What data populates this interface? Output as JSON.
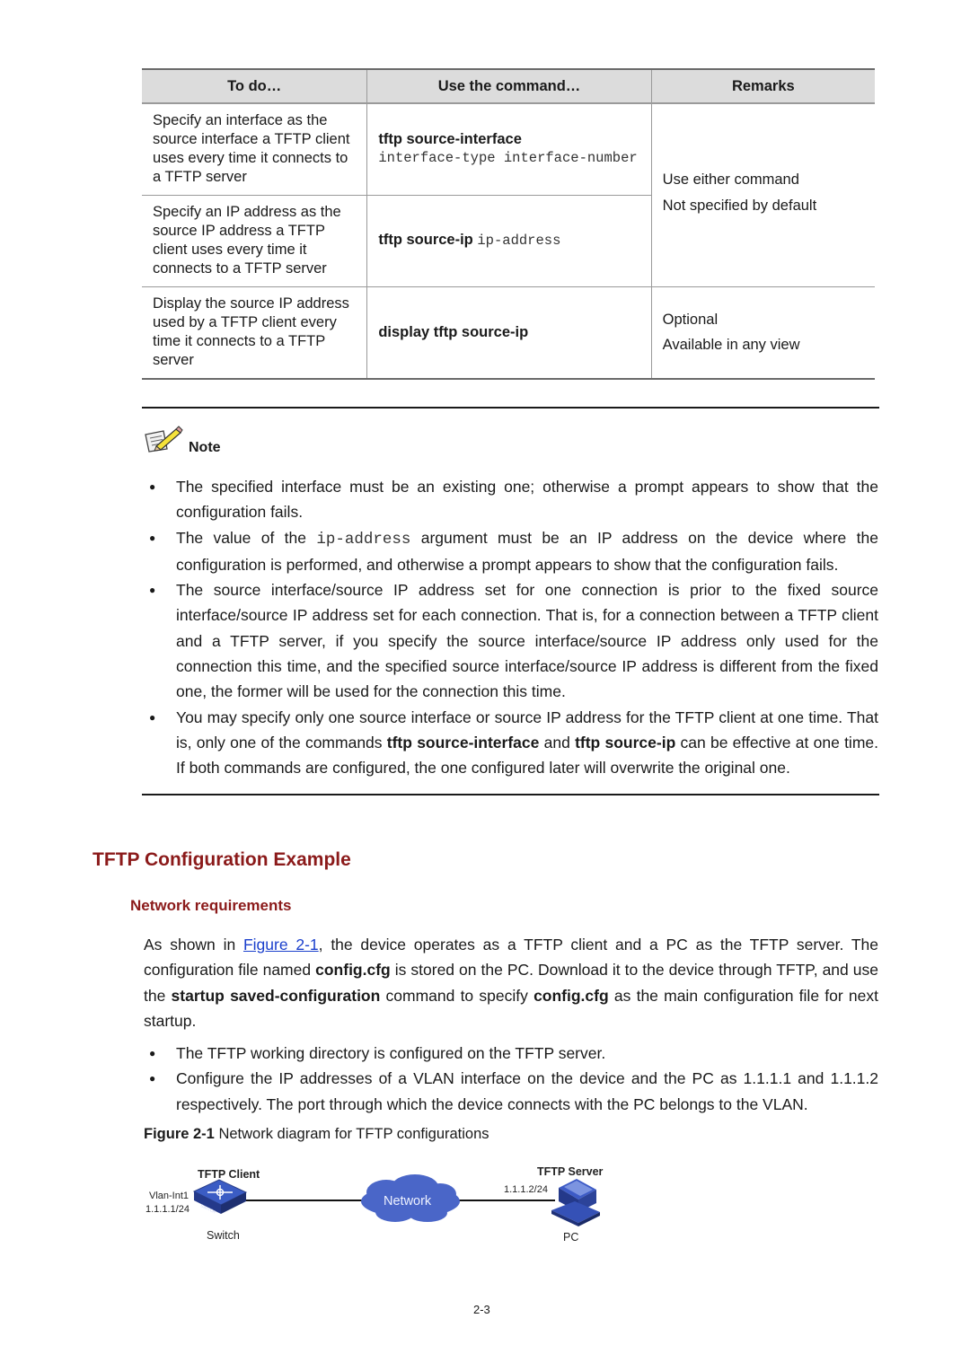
{
  "table": {
    "headers": [
      "To do…",
      "Use the command…",
      "Remarks"
    ],
    "rows": [
      {
        "todo": "Specify an interface as the source interface a TFTP client uses every time it connects to a TFTP server",
        "command_bold": "tftp source-interface",
        "command_arg": "interface-type interface-number"
      },
      {
        "todo": "Specify an IP address as the source IP address a TFTP client uses every time it connects to a TFTP server",
        "command_bold": "tftp source-ip",
        "command_arg": "ip-address"
      },
      {
        "todo": "Display the source IP address used by a TFTP client every time it connects to a TFTP server",
        "command_bold": "display tftp source-ip",
        "command_arg": "",
        "remarks": [
          "Optional",
          "Available in any view"
        ]
      }
    ],
    "shared_remarks": [
      "Use either command",
      "Not specified by default"
    ]
  },
  "note": {
    "label": "Note",
    "bullets": [
      {
        "text": "The specified interface must be an existing one; otherwise a prompt appears to show that the configuration fails."
      },
      {
        "pre": "The value of the ",
        "code": "ip-address",
        "post": " argument must be an IP address on the device where the configuration is performed, and otherwise a prompt appears to show that the configuration fails."
      },
      {
        "text": "The source interface/source IP address set for one connection is prior to the fixed source interface/source IP address set for each connection. That is, for a connection between a TFTP client and a TFTP server, if you specify the source interface/source IP address only used for the connection this time, and the specified source interface/source IP address is different from the fixed one, the former will be used for the connection this time."
      },
      {
        "p1": "You may specify only one source interface or source IP address for the TFTP client at one time. That is, only one of the commands ",
        "b1": "tftp source-interface",
        "p2": " and ",
        "b2": "tftp source-ip",
        "p3": " can be effective at one time. If both commands are configured, the one configured later will overwrite the original one."
      }
    ]
  },
  "section": {
    "title": "TFTP Configuration Example",
    "subtitle": "Network requirements",
    "para": {
      "p1": "As shown in ",
      "link": "Figure 2-1",
      "p2": ", the device operates as a TFTP client and a PC as the TFTP server. The configuration file named ",
      "b1": "config.cfg",
      "p3": " is stored on the PC. Download it to the device through TFTP, and use the ",
      "b2": "startup saved-configuration",
      "p4": " command to specify ",
      "b3": "config.cfg",
      "p5": " as the main configuration file for next startup."
    },
    "bullets": [
      "The TFTP working directory is configured on the TFTP server.",
      "Configure the IP addresses of a VLAN interface on the device and the PC as 1.1.1.1 and 1.1.1.2 respectively. The port through which the device connects with the PC belongs to the VLAN."
    ],
    "figure_caption": {
      "label": "Figure 2-1",
      "text": " Network diagram for TFTP configurations"
    }
  },
  "diagram": {
    "client_title": "TFTP Client",
    "client_iface": "Vlan-Int1",
    "client_ip": "1.1.1.1/24",
    "client_device": "Switch",
    "switch_badge": "SWITCH",
    "network_label": "Network",
    "server_title": "TFTP Server",
    "server_ip": "1.1.1.2/24",
    "server_device": "PC"
  },
  "footer": {
    "page_number": "2-3"
  }
}
